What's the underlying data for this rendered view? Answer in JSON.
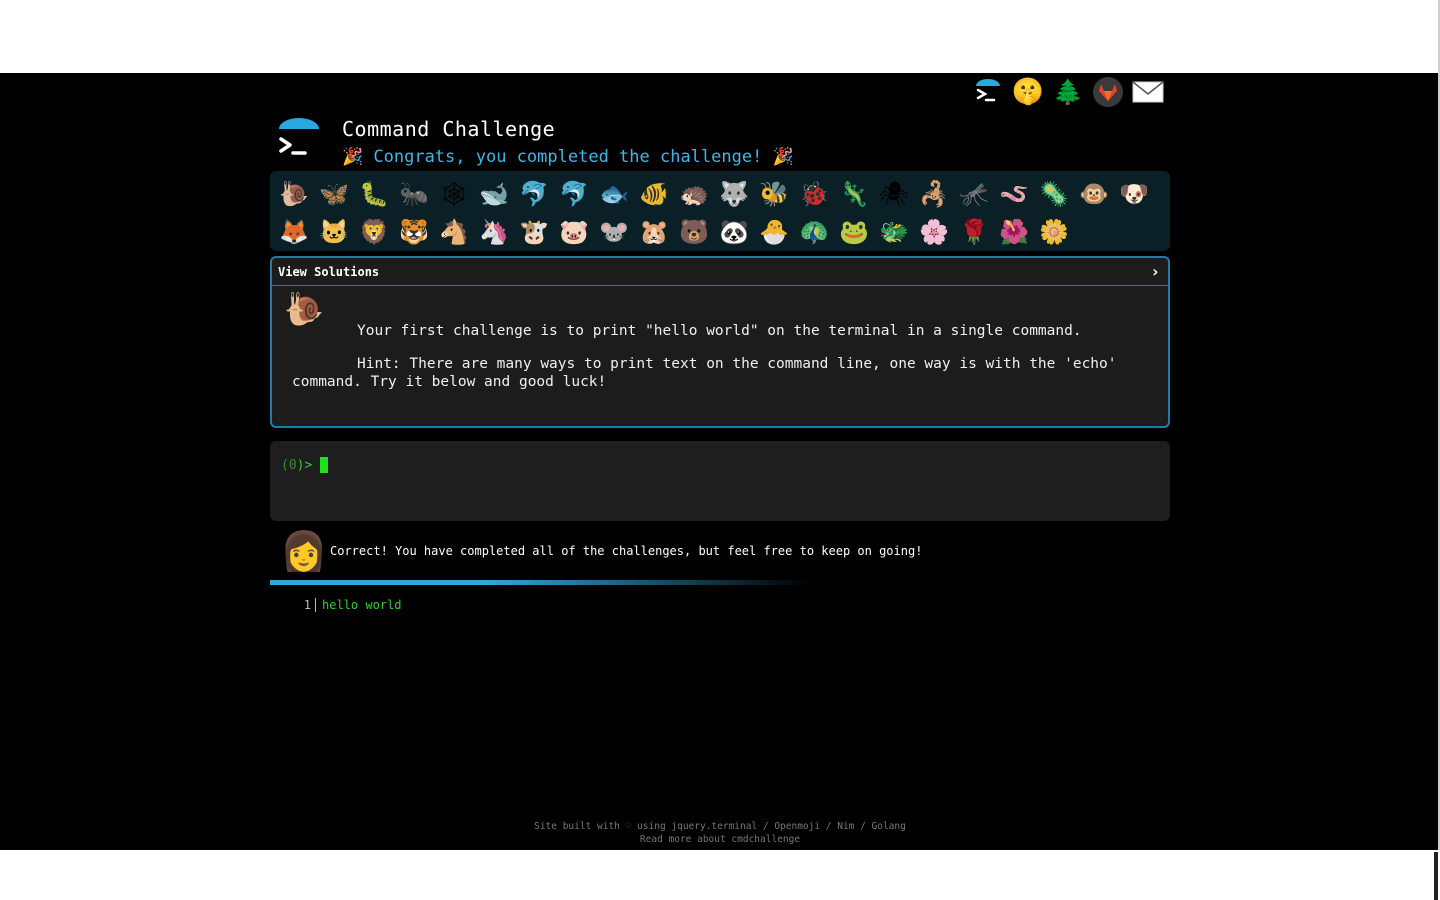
{
  "header": {
    "title": "Command Challenge",
    "subtitle": "🎉 Congrats, you completed the challenge! 🎉"
  },
  "top_icons": [
    {
      "name": "terminal-logo-icon",
      "glyph": "▶"
    },
    {
      "name": "shush-face-icon",
      "glyph": "🤫"
    },
    {
      "name": "tree-icon",
      "glyph": "🌲"
    },
    {
      "name": "gitlab-icon",
      "glyph": "🦊"
    },
    {
      "name": "mail-icon",
      "glyph": "✉"
    }
  ],
  "animals_row1": [
    "🐌",
    "🦋",
    "🐛",
    "🐜",
    "🕸",
    "🐋",
    "🐬",
    "🐬",
    "🐟",
    "🐠",
    "🦔",
    "🐺",
    "🐝",
    "🐞",
    "🦎",
    "🕷",
    "🦂",
    "🦟",
    "🪱",
    "🦠",
    "🐵",
    "🐶"
  ],
  "animals_row2": [
    "🦊",
    "🐱",
    "🦁",
    "🐯",
    "🐴",
    "🦄",
    "🐮",
    "🐷",
    "🐭",
    "🐹",
    "🐻",
    "🐼",
    "🐣",
    "🦚",
    "🐸",
    "🐲",
    "🌸",
    "🌹",
    "🌺",
    "🌼"
  ],
  "challenge": {
    "view_solutions": "View Solutions",
    "chevron": "›",
    "icon": "🐌",
    "text": "Your first challenge is to print \"hello world\" on the terminal in a single command.",
    "hint": "Hint: There are many ways to print text on the command line, one way is with the 'echo' command. Try it below and good luck!"
  },
  "terminal": {
    "prompt_open": "(",
    "prompt_code": "0",
    "prompt_close": ")>"
  },
  "result": {
    "avatar": "👩",
    "message": "Correct! You have completed all of the challenges, but feel free to keep on going!"
  },
  "output": {
    "line_number": "1",
    "text": "hello world"
  },
  "footer": {
    "line1": "Site built with ♡ using jquery.terminal / Openmoji / Nim / Golang",
    "line2": "Read more about cmdchallenge"
  }
}
